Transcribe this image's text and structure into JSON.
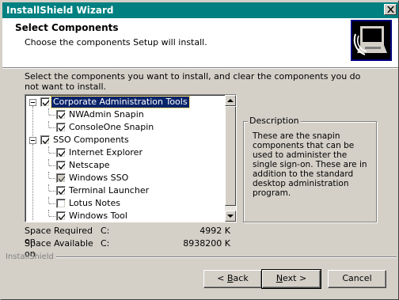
{
  "window": {
    "title": "InstallShield Wizard"
  },
  "header": {
    "title": "Select Components",
    "subtitle": "Choose the components Setup will install."
  },
  "instructions": "Select the components you want to install, and clear the components you do not want to install.",
  "tree": {
    "items": [
      {
        "label": "Corporate Administration Tools",
        "checked": true,
        "selected": true,
        "level": 0,
        "expander": true
      },
      {
        "label": "NWAdmin Snapin",
        "checked": true,
        "level": 1
      },
      {
        "label": "ConsoleOne Snapin",
        "checked": true,
        "level": 1
      },
      {
        "label": "SSO Components",
        "checked": true,
        "level": 0,
        "expander": true
      },
      {
        "label": "Internet Explorer",
        "checked": true,
        "level": 1
      },
      {
        "label": "Netscape",
        "checked": true,
        "level": 1
      },
      {
        "label": "Windows SSO",
        "checked": true,
        "grayed": true,
        "level": 1
      },
      {
        "label": "Terminal Launcher",
        "checked": true,
        "level": 1
      },
      {
        "label": "Lotus Notes",
        "checked": false,
        "level": 1
      },
      {
        "label": "Windows Tool",
        "checked": true,
        "level": 1
      }
    ]
  },
  "description": {
    "label": "Description",
    "text": "These are the snapin components that can be used to administer the single sign-on.  These are in addition to the standard desktop administration program."
  },
  "space": {
    "required_label": "Space Required on",
    "required_drive": "C:",
    "required_value": "4992 K",
    "available_label": "Space Available on",
    "available_drive": "C:",
    "available_value": "8938200 K"
  },
  "brand": "InstallShield",
  "buttons": {
    "back_accel": "B",
    "back_rest": "ack",
    "back_prefix": "< ",
    "next_accel": "N",
    "next_rest": "ext >",
    "cancel": "Cancel"
  },
  "colors": {
    "titlebar": "#008080",
    "selection": "#0a246a",
    "face": "#d4d0c8"
  }
}
